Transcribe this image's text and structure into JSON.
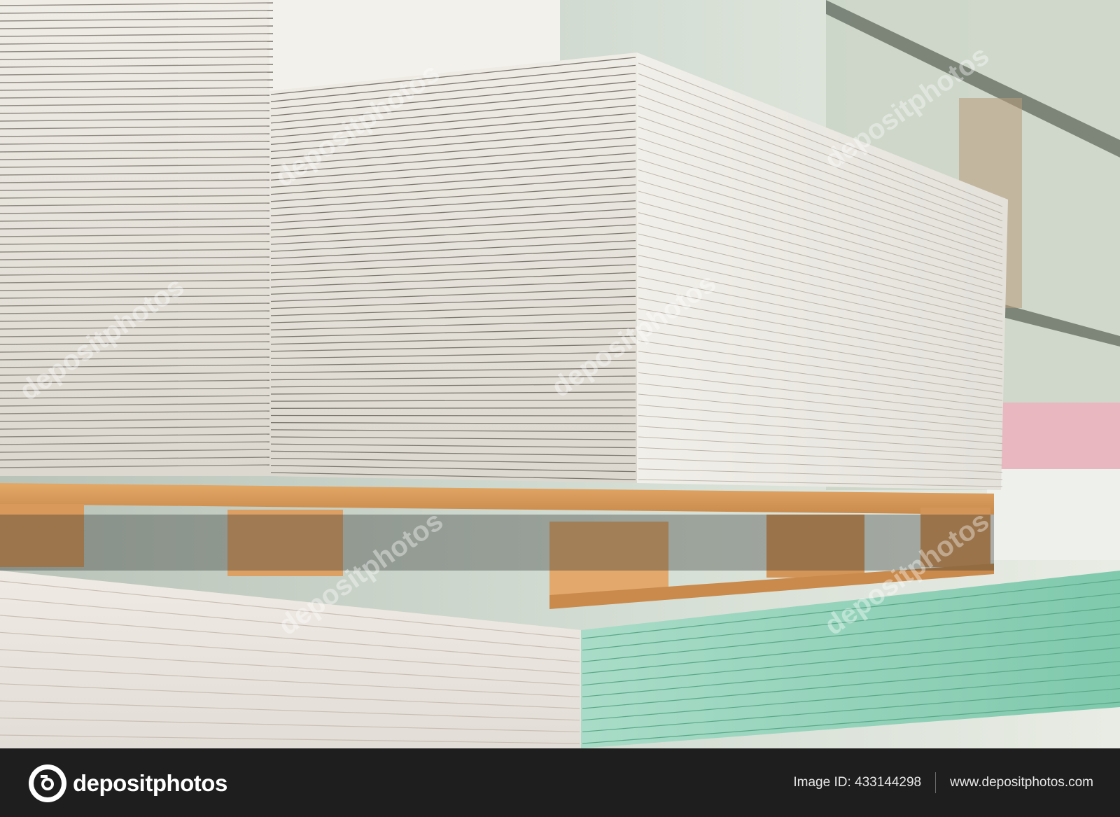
{
  "photo": {
    "subject": "stacked drywall plasterboard sheets on wooden pallet in warehouse",
    "colors": {
      "board": "#e9e6df",
      "board_edge": "#c9c4bb",
      "wood": "#d89a5a",
      "green_edge": "#8ecfb6",
      "background": "#cfd8cf"
    }
  },
  "watermark": {
    "text": "depositphotos"
  },
  "footer": {
    "logo_text": "depositphotos",
    "image_id": "Image ID: 433144298",
    "website": "www.depositphotos.com"
  }
}
